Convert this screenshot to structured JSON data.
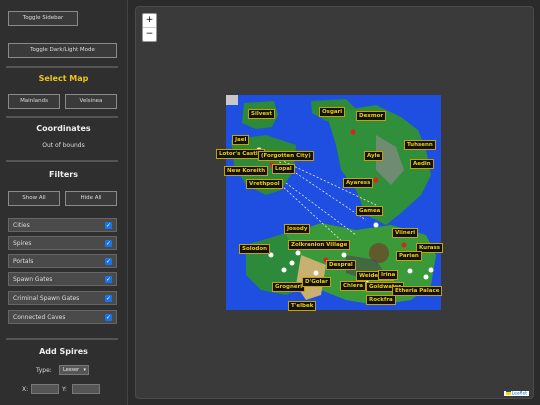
{
  "sidebar": {
    "toggle_sidebar": "Toggle Sidebar",
    "toggle_mode": "Toggle Dark/Light Mode",
    "select_map_title": "Select Map",
    "map_buttons": [
      "Mainlands",
      "Velsinea"
    ],
    "coordinates_title": "Coordinates",
    "coordinates_value": "Out of bounds",
    "filters_title": "Filters",
    "show_all": "Show All",
    "hide_all": "Hide All",
    "filters": [
      {
        "label": "Cities",
        "checked": true
      },
      {
        "label": "Spires",
        "checked": true
      },
      {
        "label": "Portals",
        "checked": true
      },
      {
        "label": "Spawn Gates",
        "checked": true
      },
      {
        "label": "Criminal Spawn Gates",
        "checked": true
      },
      {
        "label": "Connected Caves",
        "checked": true
      }
    ],
    "add_spires_title": "Add Spires",
    "type_label": "Type:",
    "type_value": "Lesser",
    "x_label": "X:",
    "y_label": "Y:"
  },
  "map": {
    "zoom_in": "+",
    "zoom_out": "−",
    "attribution": "Leaflet",
    "labels": [
      "Silvest",
      "Osgari",
      "Dexmor",
      "Jael",
      "Lotor's Castle",
      "(Forgotten City)",
      "New Koreith",
      "Lopal",
      "Vrethpool",
      "Ayle",
      "Tuhsenn",
      "Aedin",
      "Ayaress",
      "Gamea",
      "Josody",
      "Zolkranion Village",
      "Solodon",
      "Viineri",
      "Kurass",
      "Parian",
      "Despral",
      "Weiderant",
      "Grogneri",
      "D'Golar",
      "Chlera",
      "Goldwater",
      "Etheria Palace",
      "Rockfra",
      "T'elbek",
      "Irina"
    ]
  },
  "colors": {
    "label_text": "#f0d000",
    "label_border": "#c9a200",
    "ocean": "#1f4fe0",
    "land": "#2c8a3a",
    "accent_check": "#1a73e8"
  }
}
